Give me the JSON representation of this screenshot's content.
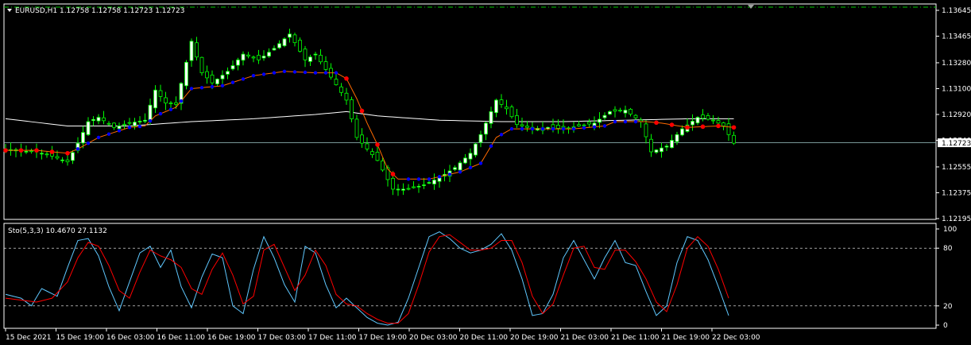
{
  "window": {
    "symbol_line": "EURUSD,H1  1.12758 1.12758 1.12723 1.12723",
    "last_price_label": "1.12723",
    "last_price": 1.12723
  },
  "colors": {
    "background": "#000000",
    "frame": "#ffffff",
    "bull_candle": "#00ff00",
    "bull_body": "#ffffff",
    "bear_body": "#000000",
    "ma_line": "#ffffff",
    "bid_line": "#a0c8c8",
    "trend_up_dot": "#0000ff",
    "trend_down_dot": "#ff0000",
    "trend_line": "#ff6a00",
    "stoch_main": "#5fc8ff",
    "stoch_signal": "#ff0000",
    "level_line": "#ffffff"
  },
  "chart_data": [
    {
      "type": "candlestick",
      "symbol": "EURUSD",
      "timeframe": "H1",
      "ylim": [
        1.12195,
        1.13645
      ],
      "y_ticks": [
        "1.13645",
        "1.13465",
        "1.13280",
        "1.13100",
        "1.12920",
        "1.12740",
        "1.12555",
        "1.12375",
        "1.12195"
      ],
      "x_tick_labels": [
        "15 Dec 2021",
        "15 Dec 19:00",
        "16 Dec 03:00",
        "16 Dec 11:00",
        "16 Dec 19:00",
        "17 Dec 03:00",
        "17 Dec 11:00",
        "17 Dec 19:00",
        "20 Dec 03:00",
        "20 Dec 11:00",
        "20 Dec 19:00",
        "21 Dec 03:00",
        "21 Dec 11:00",
        "21 Dec 19:00",
        "22 Dec 03:00"
      ],
      "anchors_close": [
        [
          0,
          1.1267
        ],
        [
          6,
          1.1266
        ],
        [
          9,
          1.1263
        ],
        [
          12,
          1.1259
        ],
        [
          14,
          1.1272
        ],
        [
          16,
          1.1287
        ],
        [
          18,
          1.129
        ],
        [
          21,
          1.1283
        ],
        [
          24,
          1.1286
        ],
        [
          27,
          1.1288
        ],
        [
          29,
          1.1309
        ],
        [
          31,
          1.13
        ],
        [
          33,
          1.1299
        ],
        [
          36,
          1.1343
        ],
        [
          38,
          1.1321
        ],
        [
          40,
          1.1314
        ],
        [
          43,
          1.1322
        ],
        [
          46,
          1.1334
        ],
        [
          49,
          1.133
        ],
        [
          52,
          1.1338
        ],
        [
          55,
          1.1348
        ],
        [
          58,
          1.133
        ],
        [
          60,
          1.1334
        ],
        [
          63,
          1.1318
        ],
        [
          66,
          1.1302
        ],
        [
          68,
          1.1276
        ],
        [
          70,
          1.1268
        ],
        [
          72,
          1.126
        ],
        [
          75,
          1.124
        ],
        [
          78,
          1.124
        ],
        [
          81,
          1.1243
        ],
        [
          84,
          1.1248
        ],
        [
          87,
          1.1255
        ],
        [
          90,
          1.1265
        ],
        [
          92,
          1.1278
        ],
        [
          95,
          1.1302
        ],
        [
          97,
          1.1296
        ],
        [
          99,
          1.1285
        ],
        [
          102,
          1.1282
        ],
        [
          105,
          1.1283
        ],
        [
          108,
          1.1282
        ],
        [
          111,
          1.1284
        ],
        [
          114,
          1.1286
        ],
        [
          117,
          1.1294
        ],
        [
          120,
          1.1295
        ],
        [
          123,
          1.1287
        ],
        [
          125,
          1.1266
        ],
        [
          128,
          1.127
        ],
        [
          131,
          1.1282
        ],
        [
          134,
          1.129
        ],
        [
          137,
          1.1288
        ],
        [
          139,
          1.1284
        ],
        [
          141,
          1.1272
        ]
      ],
      "ma_anchors": [
        [
          0,
          1.1289
        ],
        [
          12,
          1.1284
        ],
        [
          24,
          1.1284
        ],
        [
          36,
          1.1287
        ],
        [
          48,
          1.1289
        ],
        [
          60,
          1.1292
        ],
        [
          66,
          1.1294
        ],
        [
          72,
          1.1291
        ],
        [
          84,
          1.1288
        ],
        [
          96,
          1.1287
        ],
        [
          108,
          1.1287
        ],
        [
          120,
          1.1288
        ],
        [
          132,
          1.1289
        ],
        [
          141,
          1.1289
        ]
      ],
      "trend_anchors": [
        [
          0,
          1.1267
        ],
        [
          6,
          1.1267
        ],
        [
          12,
          1.1265
        ],
        [
          14,
          1.1268
        ],
        [
          18,
          1.1276
        ],
        [
          24,
          1.1283
        ],
        [
          27,
          1.1284
        ],
        [
          29,
          1.1291
        ],
        [
          33,
          1.1297
        ],
        [
          36,
          1.131
        ],
        [
          42,
          1.1312
        ],
        [
          48,
          1.1319
        ],
        [
          54,
          1.1322
        ],
        [
          60,
          1.1321
        ],
        [
          64,
          1.1321
        ],
        [
          66,
          1.1317
        ],
        [
          68,
          1.1303
        ],
        [
          70,
          1.1286
        ],
        [
          72,
          1.1271
        ],
        [
          74,
          1.1254
        ],
        [
          76,
          1.1247
        ],
        [
          82,
          1.1247
        ],
        [
          88,
          1.1252
        ],
        [
          92,
          1.1258
        ],
        [
          95,
          1.1276
        ],
        [
          98,
          1.1282
        ],
        [
          104,
          1.1282
        ],
        [
          110,
          1.1282
        ],
        [
          116,
          1.1284
        ],
        [
          118,
          1.1287
        ],
        [
          124,
          1.1287
        ],
        [
          127,
          1.1286
        ],
        [
          132,
          1.1283
        ],
        [
          138,
          1.1284
        ],
        [
          141,
          1.1283
        ]
      ],
      "trend_direction": [
        [
          0,
          12,
          "down"
        ],
        [
          13,
          65,
          "up"
        ],
        [
          66,
          77,
          "down"
        ],
        [
          78,
          123,
          "up"
        ],
        [
          124,
          141,
          "down"
        ]
      ]
    },
    {
      "type": "line",
      "indicator_label": "Sto(5,3,3) 10.4670 27.1132",
      "ylim": [
        0,
        100
      ],
      "y_ticks": [
        "100",
        "80",
        "20",
        "0"
      ],
      "levels": [
        80,
        20
      ],
      "main_anchors": [
        [
          0,
          32
        ],
        [
          3,
          28
        ],
        [
          5,
          20
        ],
        [
          7,
          38
        ],
        [
          10,
          30
        ],
        [
          12,
          60
        ],
        [
          14,
          88
        ],
        [
          16,
          90
        ],
        [
          18,
          72
        ],
        [
          20,
          40
        ],
        [
          22,
          15
        ],
        [
          24,
          45
        ],
        [
          26,
          75
        ],
        [
          28,
          82
        ],
        [
          30,
          60
        ],
        [
          32,
          78
        ],
        [
          34,
          40
        ],
        [
          36,
          18
        ],
        [
          38,
          50
        ],
        [
          40,
          74
        ],
        [
          42,
          70
        ],
        [
          44,
          20
        ],
        [
          46,
          12
        ],
        [
          48,
          58
        ],
        [
          50,
          92
        ],
        [
          52,
          70
        ],
        [
          54,
          42
        ],
        [
          56,
          24
        ],
        [
          58,
          82
        ],
        [
          60,
          75
        ],
        [
          62,
          42
        ],
        [
          64,
          18
        ],
        [
          66,
          28
        ],
        [
          68,
          18
        ],
        [
          70,
          8
        ],
        [
          72,
          2
        ],
        [
          74,
          0
        ],
        [
          76,
          3
        ],
        [
          78,
          28
        ],
        [
          80,
          60
        ],
        [
          82,
          92
        ],
        [
          84,
          97
        ],
        [
          86,
          90
        ],
        [
          88,
          80
        ],
        [
          90,
          75
        ],
        [
          92,
          78
        ],
        [
          94,
          84
        ],
        [
          96,
          95
        ],
        [
          98,
          78
        ],
        [
          100,
          48
        ],
        [
          102,
          10
        ],
        [
          104,
          12
        ],
        [
          106,
          32
        ],
        [
          108,
          70
        ],
        [
          110,
          88
        ],
        [
          112,
          68
        ],
        [
          114,
          48
        ],
        [
          116,
          70
        ],
        [
          118,
          88
        ],
        [
          120,
          65
        ],
        [
          122,
          62
        ],
        [
          124,
          35
        ],
        [
          126,
          10
        ],
        [
          128,
          20
        ],
        [
          130,
          65
        ],
        [
          132,
          92
        ],
        [
          134,
          88
        ],
        [
          136,
          68
        ],
        [
          138,
          40
        ],
        [
          140,
          10
        ]
      ],
      "signal_anchors": [
        [
          0,
          28
        ],
        [
          3,
          26
        ],
        [
          6,
          24
        ],
        [
          9,
          28
        ],
        [
          12,
          45
        ],
        [
          14,
          70
        ],
        [
          16,
          86
        ],
        [
          18,
          82
        ],
        [
          20,
          62
        ],
        [
          22,
          36
        ],
        [
          24,
          28
        ],
        [
          26,
          55
        ],
        [
          28,
          78
        ],
        [
          30,
          72
        ],
        [
          32,
          68
        ],
        [
          34,
          60
        ],
        [
          36,
          38
        ],
        [
          38,
          32
        ],
        [
          40,
          58
        ],
        [
          42,
          75
        ],
        [
          44,
          52
        ],
        [
          46,
          22
        ],
        [
          48,
          30
        ],
        [
          50,
          78
        ],
        [
          52,
          84
        ],
        [
          54,
          60
        ],
        [
          56,
          36
        ],
        [
          58,
          52
        ],
        [
          60,
          78
        ],
        [
          62,
          62
        ],
        [
          64,
          32
        ],
        [
          66,
          22
        ],
        [
          68,
          20
        ],
        [
          70,
          12
        ],
        [
          72,
          6
        ],
        [
          74,
          2
        ],
        [
          76,
          2
        ],
        [
          78,
          12
        ],
        [
          80,
          42
        ],
        [
          82,
          76
        ],
        [
          84,
          92
        ],
        [
          86,
          94
        ],
        [
          88,
          86
        ],
        [
          90,
          78
        ],
        [
          92,
          78
        ],
        [
          94,
          80
        ],
        [
          96,
          88
        ],
        [
          98,
          88
        ],
        [
          100,
          65
        ],
        [
          102,
          30
        ],
        [
          104,
          12
        ],
        [
          106,
          22
        ],
        [
          108,
          52
        ],
        [
          110,
          80
        ],
        [
          112,
          82
        ],
        [
          114,
          60
        ],
        [
          116,
          58
        ],
        [
          118,
          78
        ],
        [
          120,
          78
        ],
        [
          122,
          66
        ],
        [
          124,
          48
        ],
        [
          126,
          24
        ],
        [
          128,
          14
        ],
        [
          130,
          42
        ],
        [
          132,
          80
        ],
        [
          134,
          92
        ],
        [
          136,
          82
        ],
        [
          138,
          58
        ],
        [
          140,
          28
        ]
      ]
    }
  ]
}
